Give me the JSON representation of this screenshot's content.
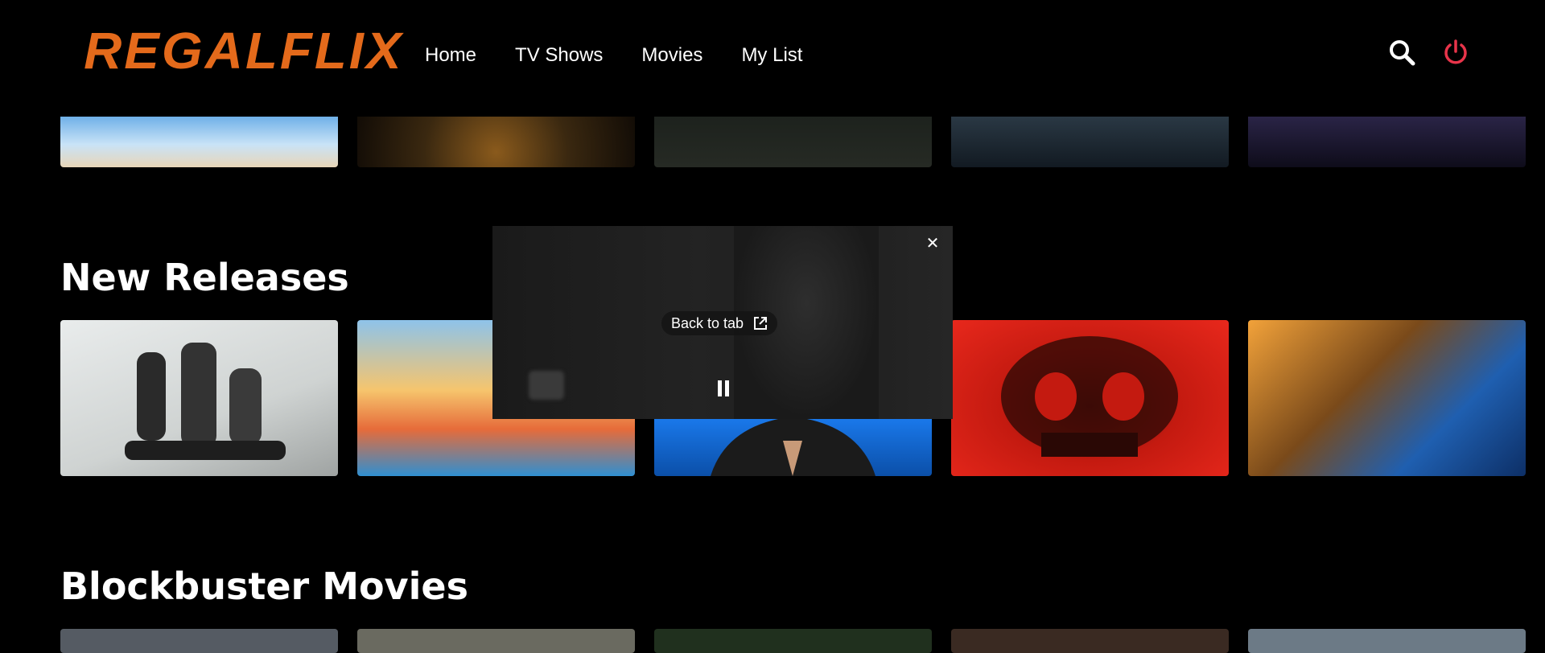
{
  "brand": {
    "name": "REGALFLIX",
    "color": "#e46a1b"
  },
  "nav": {
    "items": [
      {
        "label": "Home"
      },
      {
        "label": "TV Shows"
      },
      {
        "label": "Movies"
      },
      {
        "label": "My List"
      }
    ],
    "icons": [
      "search-icon",
      "power-icon"
    ],
    "power_color": "#e8344a"
  },
  "rows": [
    {
      "title": "",
      "thumbnails": [
        "thumb-1",
        "thumb-2",
        "thumb-3",
        "thumb-4",
        "thumb-5"
      ]
    },
    {
      "title": "New Releases",
      "thumbnails": [
        "thumb-1",
        "thumb-2",
        "thumb-3",
        "thumb-4",
        "thumb-5"
      ]
    },
    {
      "title": "Blockbuster Movies",
      "thumbnails": [
        "thumb-1",
        "thumb-2",
        "thumb-3",
        "thumb-4",
        "thumb-5"
      ]
    }
  ],
  "pip": {
    "back_label": "Back to tab",
    "icons": [
      "close-icon",
      "open-external-icon",
      "pause-icon"
    ]
  }
}
